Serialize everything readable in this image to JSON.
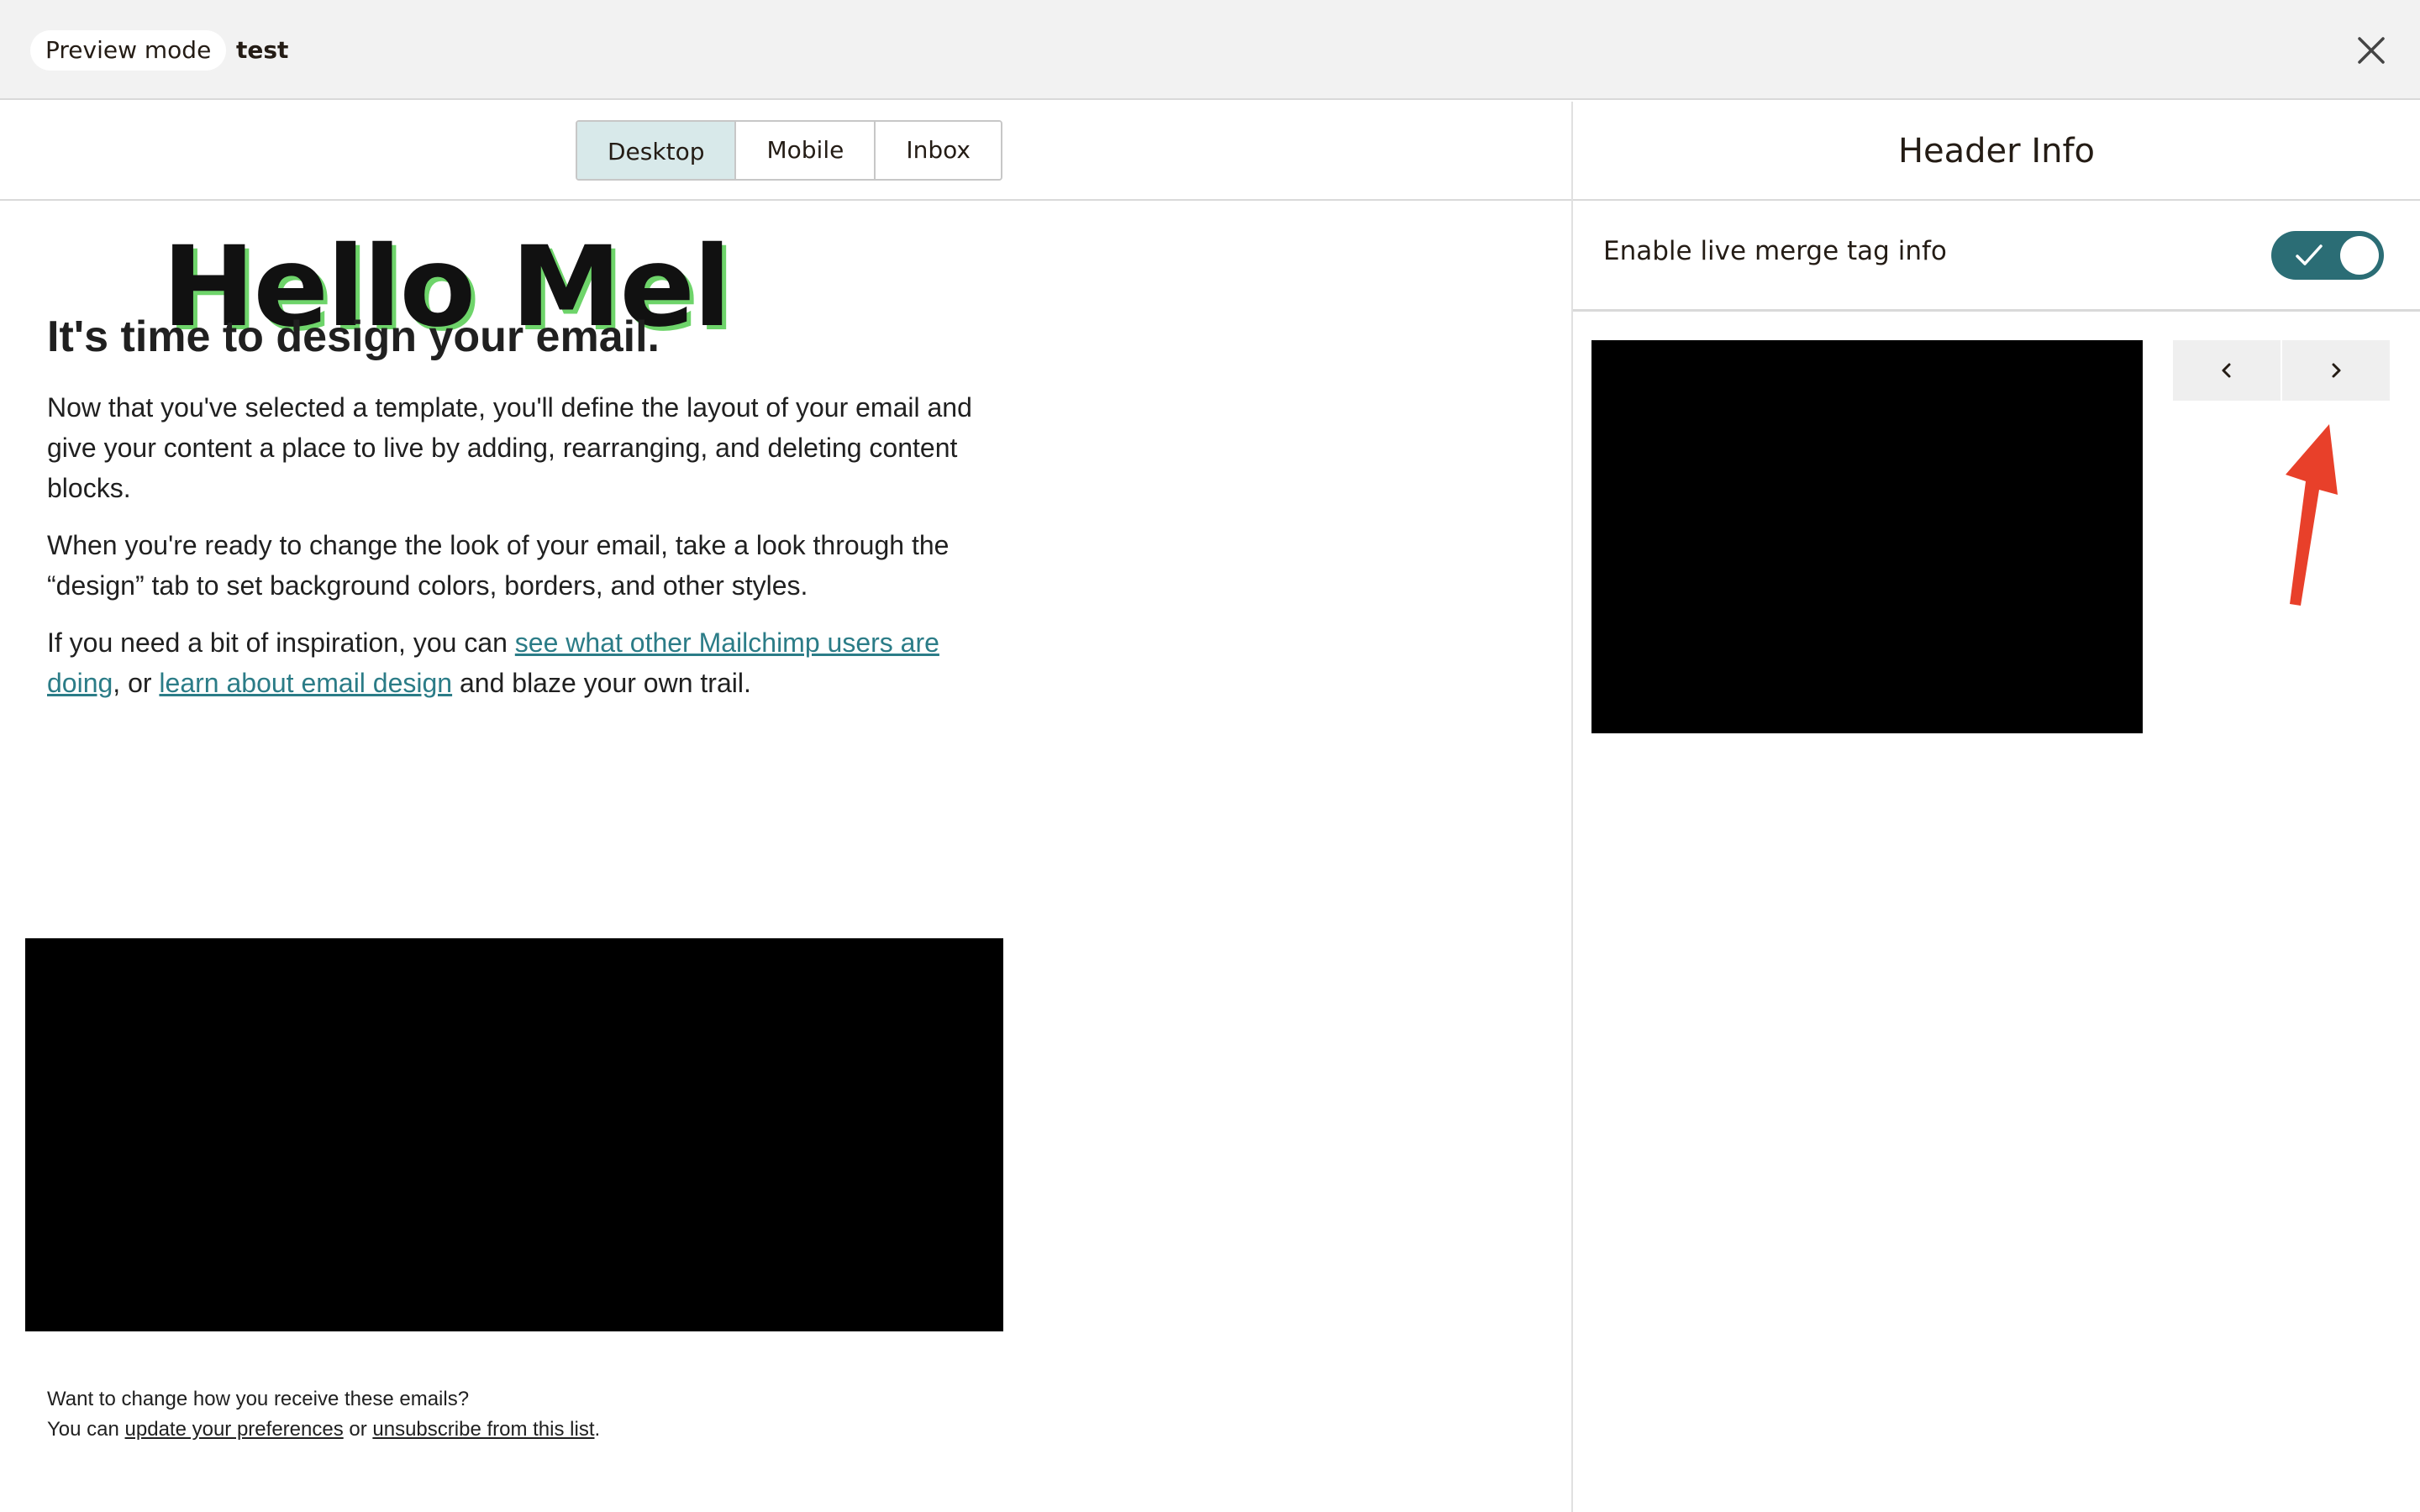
{
  "topbar": {
    "preview_mode_label": "Preview mode",
    "campaign_name": "test"
  },
  "tabs": [
    {
      "label": "Desktop",
      "active": true
    },
    {
      "label": "Mobile",
      "active": false
    },
    {
      "label": "Inbox",
      "active": false
    }
  ],
  "email": {
    "header_text": "Hello Mel",
    "heading": "It's time to design your email.",
    "para1": "Now that you've selected a template, you'll define the layout of your email and give your content a place to live by adding, rearranging, and deleting content blocks.",
    "para2": "When you're ready to change the look of your email, take a look through the “design” tab to set background colors, borders, and other styles.",
    "para3_start": "If you need a bit of inspiration, you can ",
    "link1": "see what other Mailchimp users are doing",
    "para3_mid": ", or ",
    "link2": "learn about email design",
    "para3_end": " and blaze your own trail.",
    "footer_line1": "Want to change how you receive these emails?",
    "footer_line2_start": "You can ",
    "footer_link1": "update your preferences",
    "footer_line2_mid": " or ",
    "footer_link2": "unsubscribe from this list",
    "footer_line2_end": "."
  },
  "right_panel": {
    "title": "Header Info",
    "merge_toggle_label": "Enable live merge tag info",
    "merge_toggle_on": true
  },
  "colors": {
    "accent": "#2b6d75",
    "link": "#2b7c87",
    "active_tab_bg": "#d8e9ea",
    "annotation_arrow": "#e8402a"
  },
  "icons": {
    "close": "close-icon",
    "prev": "chevron-left-icon",
    "next": "chevron-right-icon",
    "toggle_check": "check-icon"
  }
}
